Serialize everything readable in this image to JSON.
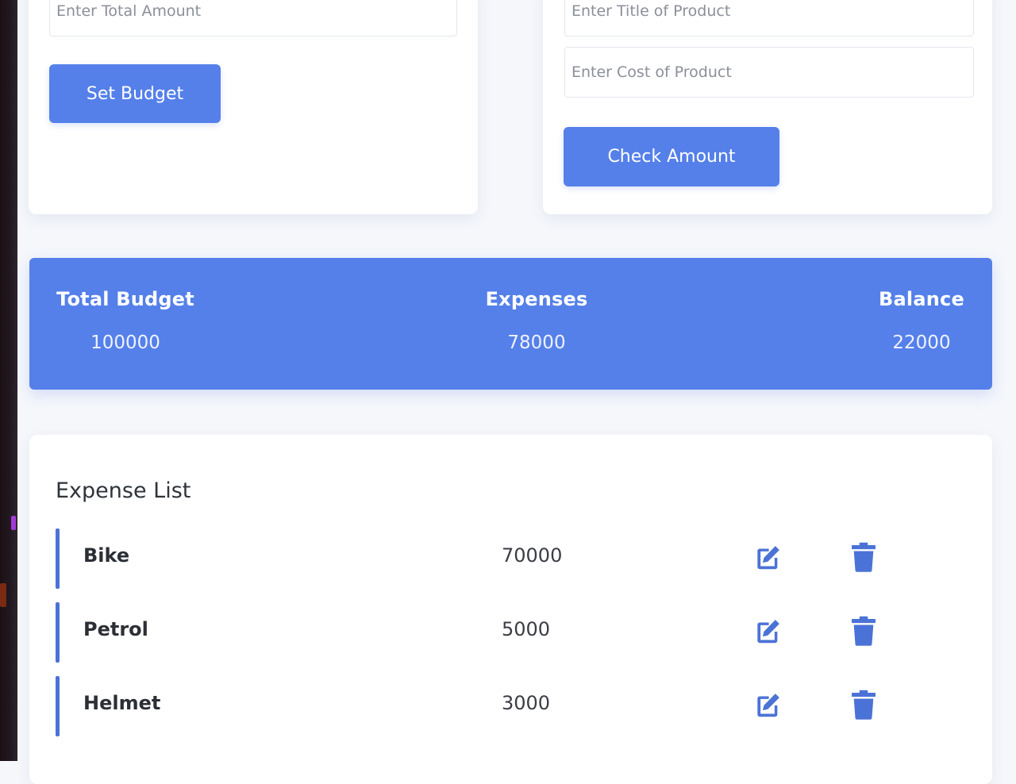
{
  "budget_form": {
    "amount_placeholder": "Enter Total Amount",
    "button_label": "Set Budget"
  },
  "product_form": {
    "title_placeholder": "Enter Title of Product",
    "cost_placeholder": "Enter Cost of Product",
    "button_label": "Check Amount"
  },
  "summary": {
    "budget_label": "Total Budget",
    "budget_value": "100000",
    "expenses_label": "Expenses",
    "expenses_value": "78000",
    "balance_label": "Balance",
    "balance_value": "22000"
  },
  "expense_list": {
    "title": "Expense List",
    "items": [
      {
        "name": "Bike",
        "amount": "70000"
      },
      {
        "name": "Petrol",
        "amount": "5000"
      },
      {
        "name": "Helmet",
        "amount": "3000"
      }
    ],
    "edit_icon": "edit-icon",
    "delete_icon": "trash-icon"
  },
  "colors": {
    "accent": "#5580ea",
    "background": "#f5f7fb",
    "card": "#ffffff"
  }
}
